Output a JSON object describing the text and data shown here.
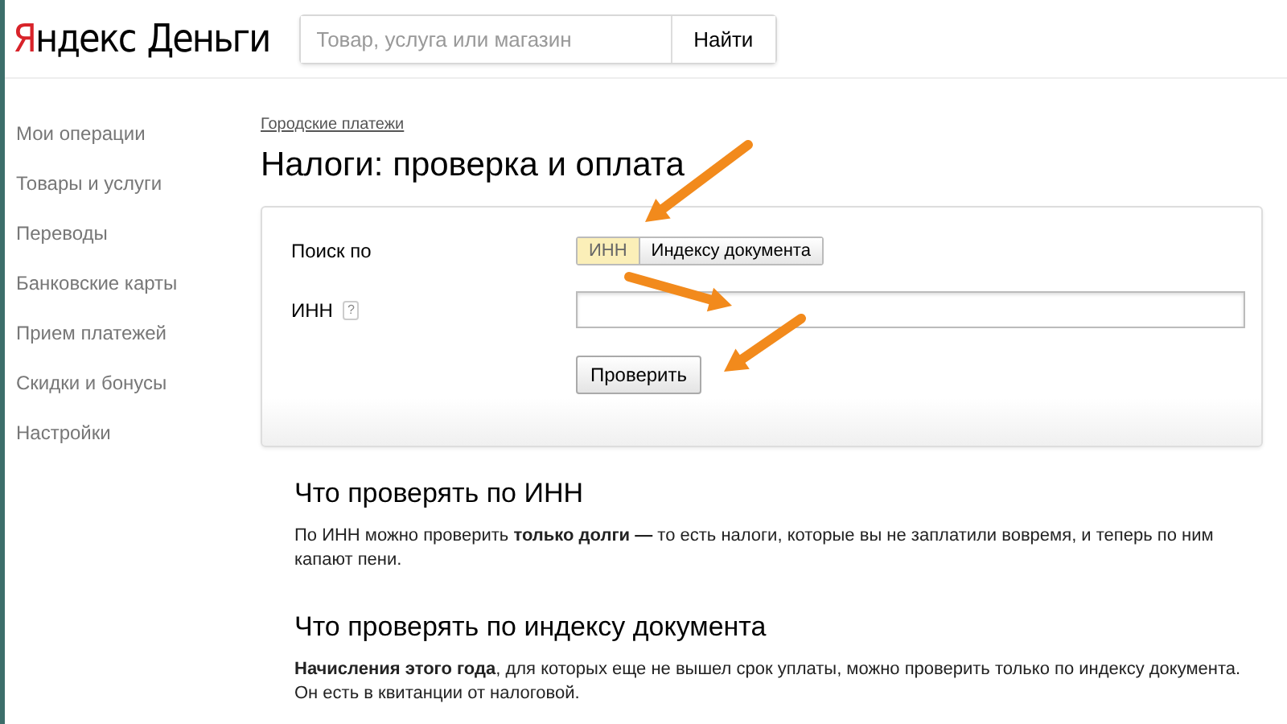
{
  "header": {
    "logo_first": "Я",
    "logo_rest": "ндекс",
    "logo_second": "Деньги",
    "search": {
      "placeholder": "Товар, услуга или магазин"
    },
    "search_button": "Найти"
  },
  "sidebar": {
    "items": [
      {
        "label": "Мои операции"
      },
      {
        "label": "Товары и услуги"
      },
      {
        "label": "Переводы"
      },
      {
        "label": "Банковские карты"
      },
      {
        "label": "Прием платежей"
      },
      {
        "label": "Скидки и бонусы"
      },
      {
        "label": "Настройки"
      }
    ]
  },
  "breadcrumb": "Городские платежи",
  "title": "Налоги: проверка и оплата",
  "form": {
    "search_by_label": "Поиск по",
    "search_by_options": [
      {
        "label": "ИНН",
        "selected": true
      },
      {
        "label": "Индексу документа",
        "selected": false
      }
    ],
    "inn_label": "ИНН",
    "help_mark": "?",
    "submit": "Проверить"
  },
  "sections": [
    {
      "heading": "Что проверять по ИНН",
      "text": "По ИНН можно проверить **только долги —** то есть налоги, которые вы не заплатили вовремя, и теперь по ним капают пени."
    },
    {
      "heading": "Что проверять по индексу документа",
      "text": "**Начисления этого года**, для которых еще не вышел срок уплаты, можно проверить только по индексу документа. Он есть в квитанции от налоговой."
    }
  ]
}
